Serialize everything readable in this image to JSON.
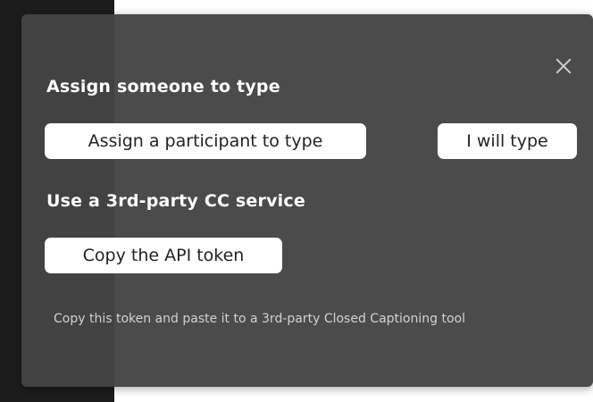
{
  "dialog": {
    "close_icon": "close-icon",
    "assign_section": {
      "heading": "Assign someone to type",
      "assign_participant_label": "Assign a participant to type",
      "self_type_label": "I will type"
    },
    "third_party_section": {
      "heading": "Use a 3rd-party CC service",
      "copy_token_label": "Copy the API token",
      "description": "Copy this token and paste it to a 3rd-party Closed Captioning tool"
    }
  }
}
